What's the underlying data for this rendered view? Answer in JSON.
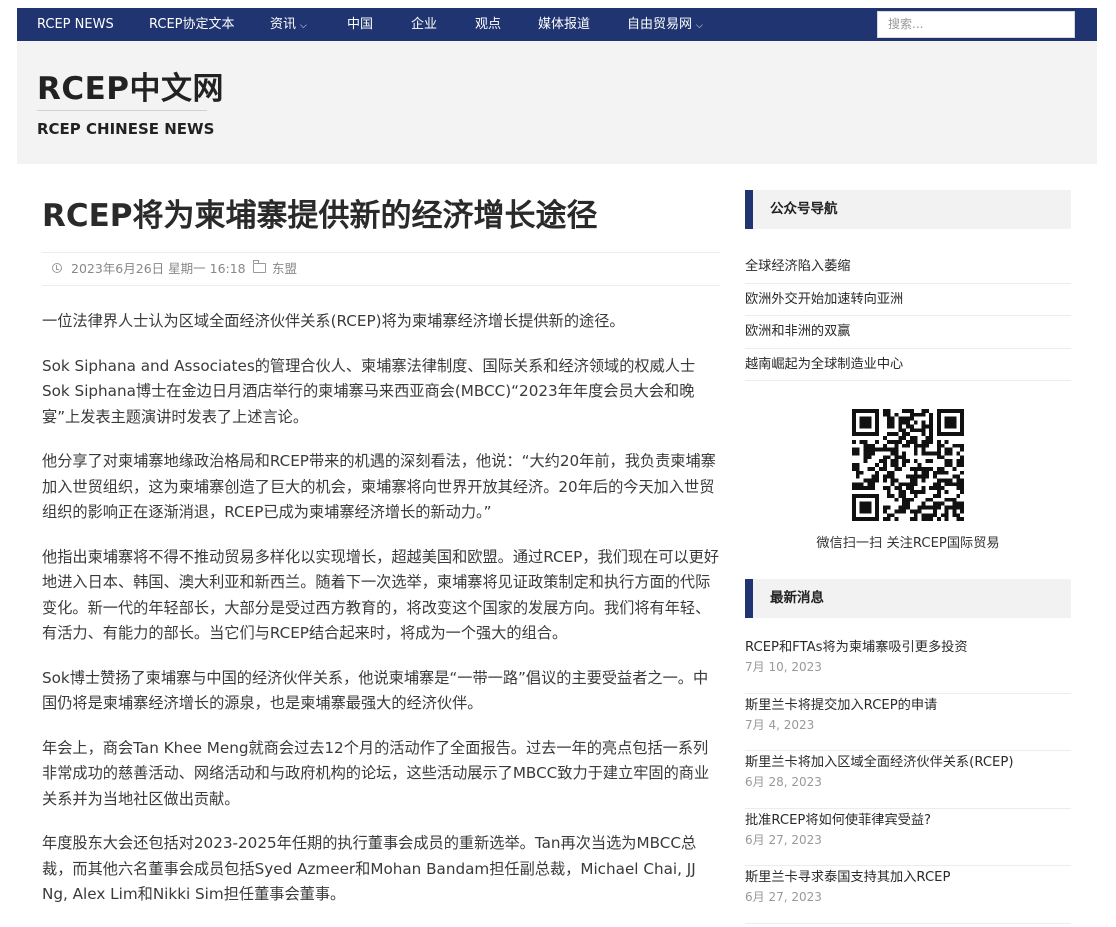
{
  "nav": {
    "items": [
      {
        "label": "RCEP NEWS",
        "dropdown": false
      },
      {
        "label": "RCEP协定文本",
        "dropdown": false
      },
      {
        "label": "资讯",
        "dropdown": true
      },
      {
        "label": "中国",
        "dropdown": false
      },
      {
        "label": "企业",
        "dropdown": false
      },
      {
        "label": "观点",
        "dropdown": false
      },
      {
        "label": "媒体报道",
        "dropdown": false
      },
      {
        "label": "自由贸易网",
        "dropdown": true
      }
    ],
    "search_placeholder": "搜索..."
  },
  "header": {
    "site_title": "RCEP中文网",
    "site_subtitle": "RCEP CHINESE NEWS"
  },
  "article": {
    "title": "RCEP将为柬埔寨提供新的经济增长途径",
    "date": "2023年6月26日 星期一 16:18",
    "category": "东盟",
    "paragraphs": [
      "一位法律界人士认为区域全面经济伙伴关系(RCEP)将为柬埔寨经济增长提供新的途径。",
      "Sok Siphana and Associates的管理合伙人、柬埔寨法律制度、国际关系和经济领域的权威人士Sok Siphana博士在金边日月酒店举行的柬埔寨马来西亚商会(MBCC)“2023年年度会员大会和晚宴”上发表主题演讲时发表了上述言论。",
      "他分享了对柬埔寨地缘政治格局和RCEP带来的机遇的深刻看法，他说：“大约20年前，我负责柬埔寨加入世贸组织，这为柬埔寨创造了巨大的机会，柬埔寨将向世界开放其经济。20年后的今天加入世贸组织的影响正在逐渐消退，RCEP已成为柬埔寨经济增长的新动力。”",
      "他指出柬埔寨将不得不推动贸易多样化以实现增长，超越美国和欧盟。通过RCEP，我们现在可以更好地进入日本、韩国、澳大利亚和新西兰。随着下一次选举，柬埔寨将见证政策制定和执行方面的代际变化。新一代的年轻部长，大部分是受过西方教育的，将改变这个国家的发展方向。我们将有年轻、有活力、有能力的部长。当它们与RCEP结合起来时，将成为一个强大的组合。",
      "Sok博士赞扬了柬埔寨与中国的经济伙伴关系，他说柬埔寨是“一带一路”倡议的主要受益者之一。中国仍将是柬埔寨经济增长的源泉，也是柬埔寨最强大的经济伙伴。",
      "年会上，商会Tan Khee Meng就商会过去12个月的活动作了全面报告。过去一年的亮点包括一系列非常成功的慈善活动、网络活动和与政府机构的论坛，这些活动展示了MBCC致力于建立牢固的商业关系并为当地社区做出贡献。",
      "年度股东大会还包括对2023-2025年任期的执行董事会成员的重新选举。Tan再次当选为MBCC总裁，而其他六名董事会成员包括Syed Azmeer和Mohan Bandam担任副总裁，Michael Chai, JJ Ng, Alex Lim和Nikki Sim担任董事会董事。"
    ]
  },
  "sidebar": {
    "wechat_nav": {
      "heading": "公众号导航",
      "links": [
        "全球经济陷入萎缩",
        "欧洲外交开始加速转向亚洲",
        "欧洲和非洲的双赢",
        "越南崛起为全球制造业中心"
      ]
    },
    "qr_caption": "微信扫一扫   关注RCEP国际贸易",
    "latest": {
      "heading": "最新消息",
      "items": [
        {
          "title": "RCEP和FTAs将为柬埔寨吸引更多投资",
          "date": "7月 10, 2023"
        },
        {
          "title": "斯里兰卡将提交加入RCEP的申请",
          "date": "7月 4, 2023"
        },
        {
          "title": "斯里兰卡将加入区域全面经济伙伴关系(RCEP)",
          "date": "6月 28, 2023"
        },
        {
          "title": "批准RCEP将如何使菲律宾受益?",
          "date": "6月 27, 2023"
        },
        {
          "title": "斯里兰卡寻求泰国支持其加入RCEP",
          "date": "6月 27, 2023"
        }
      ]
    }
  },
  "colors": {
    "nav_bg": "#1f3470",
    "accent": "#1f3470",
    "header_bg": "#f3f3f3"
  }
}
